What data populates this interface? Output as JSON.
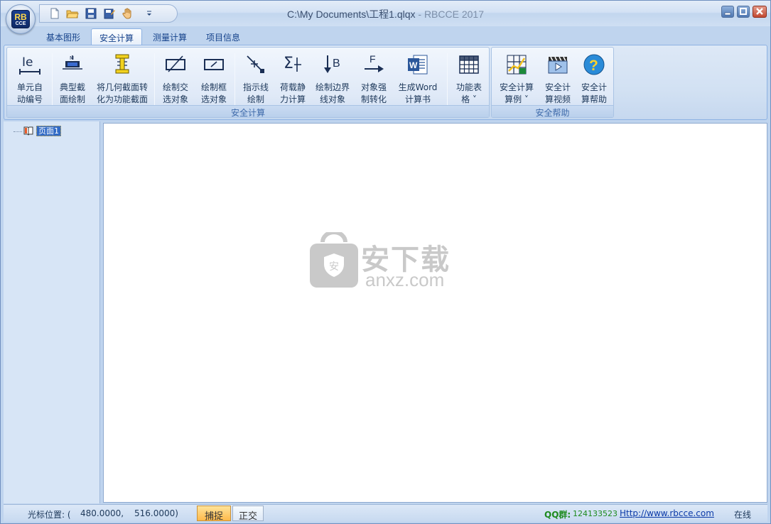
{
  "window": {
    "title_path": "C:\\My Documents\\工程1.qlqx",
    "title_app": " - RBCCE 2017"
  },
  "app_orb": {
    "line1": "RB",
    "line2": "CCE"
  },
  "quick_access": [
    "new-icon",
    "open-icon",
    "save-icon",
    "save-as-icon",
    "hand-icon",
    "customize-dropdown-icon"
  ],
  "tabs": [
    {
      "label": "基本图形",
      "active": false
    },
    {
      "label": "安全计算",
      "active": true
    },
    {
      "label": "测量计算",
      "active": false
    },
    {
      "label": "项目信息",
      "active": false
    }
  ],
  "ribbon": {
    "group_calc": {
      "label": "安全计算",
      "buttons": [
        {
          "l1": "单元自",
          "l2": "动编号",
          "icon": "element-numbering-icon"
        },
        {
          "l1": "典型截",
          "l2": "面绘制",
          "icon": "typical-section-icon"
        },
        {
          "l1": "将几何截面转",
          "l2": "化为功能截面",
          "icon": "convert-section-icon"
        },
        {
          "l1": "绘制交",
          "l2": "选对象",
          "icon": "cross-select-icon"
        },
        {
          "l1": "绘制框",
          "l2": "选对象",
          "icon": "box-select-icon"
        },
        {
          "l1": "指示线",
          "l2": "绘制",
          "icon": "leader-line-icon"
        },
        {
          "l1": "荷载静",
          "l2": "力计算",
          "icon": "load-static-icon"
        },
        {
          "l1": "绘制边界",
          "l2": "线对象",
          "icon": "boundary-line-icon"
        },
        {
          "l1": "对象强",
          "l2": "制转化",
          "icon": "force-convert-icon"
        },
        {
          "l1": "生成Word",
          "l2": "计算书",
          "icon": "word-icon"
        },
        {
          "l1": "功能表",
          "l2": "格 ˅",
          "icon": "table-grid-icon"
        }
      ]
    },
    "group_help": {
      "label": "安全帮助",
      "buttons": [
        {
          "l1": "安全计算",
          "l2": "算例 ˅",
          "icon": "example-chart-icon"
        },
        {
          "l1": "安全计",
          "l2": "算视频",
          "icon": "video-icon"
        },
        {
          "l1": "安全计",
          "l2": "算帮助",
          "icon": "help-icon"
        }
      ]
    }
  },
  "tree": {
    "node_label": "页面1"
  },
  "watermark": {
    "main": "安下载",
    "sub": "anxz.com"
  },
  "status": {
    "cursor_label": "光标位置: (",
    "cursor_x": "480.0000,",
    "cursor_y": "516.0000)",
    "snap": "捕捉",
    "ortho": "正交",
    "qq_label": "QQ群:",
    "qq_number": "124133523",
    "site": "Http://www.rbcce.com",
    "online": "在线"
  },
  "colors": {
    "accent": "#15428b",
    "ribbon_bg": "#dfe9f7",
    "snap_active": "#ffb94a",
    "qq_green": "#1d8a1d",
    "selection": "#316ac5"
  }
}
